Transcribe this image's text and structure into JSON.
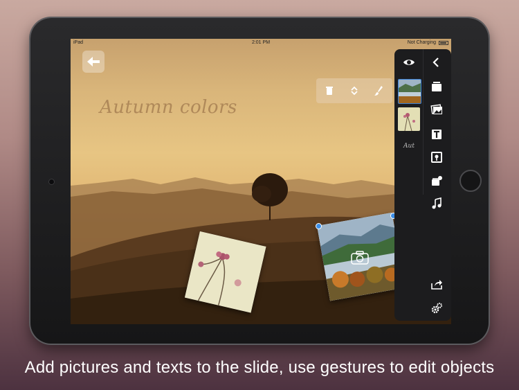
{
  "status_bar": {
    "carrier": "iPad",
    "time": "2:01 PM",
    "battery_text": "Not Charging"
  },
  "slide": {
    "title": "Autumn colors"
  },
  "side_panel": {
    "thumbnail_text": "Aut",
    "icons": [
      "eye-icon",
      "back-chevron-icon",
      "layers-icon",
      "photos-icon",
      "text-icon",
      "frame-icon",
      "stickers-icon",
      "music-note-icon",
      "share-icon",
      "settings-icon"
    ]
  },
  "edit_toolbar": {
    "icons": [
      "trash-icon",
      "reorder-icon",
      "brush-icon"
    ]
  },
  "caption": "Add pictures and texts to the slide, use gestures to edit objects",
  "colors": {
    "panel_bg": "#1c1c1e",
    "handle_blue": "#3b8ee8",
    "title_color": "#966e46"
  }
}
